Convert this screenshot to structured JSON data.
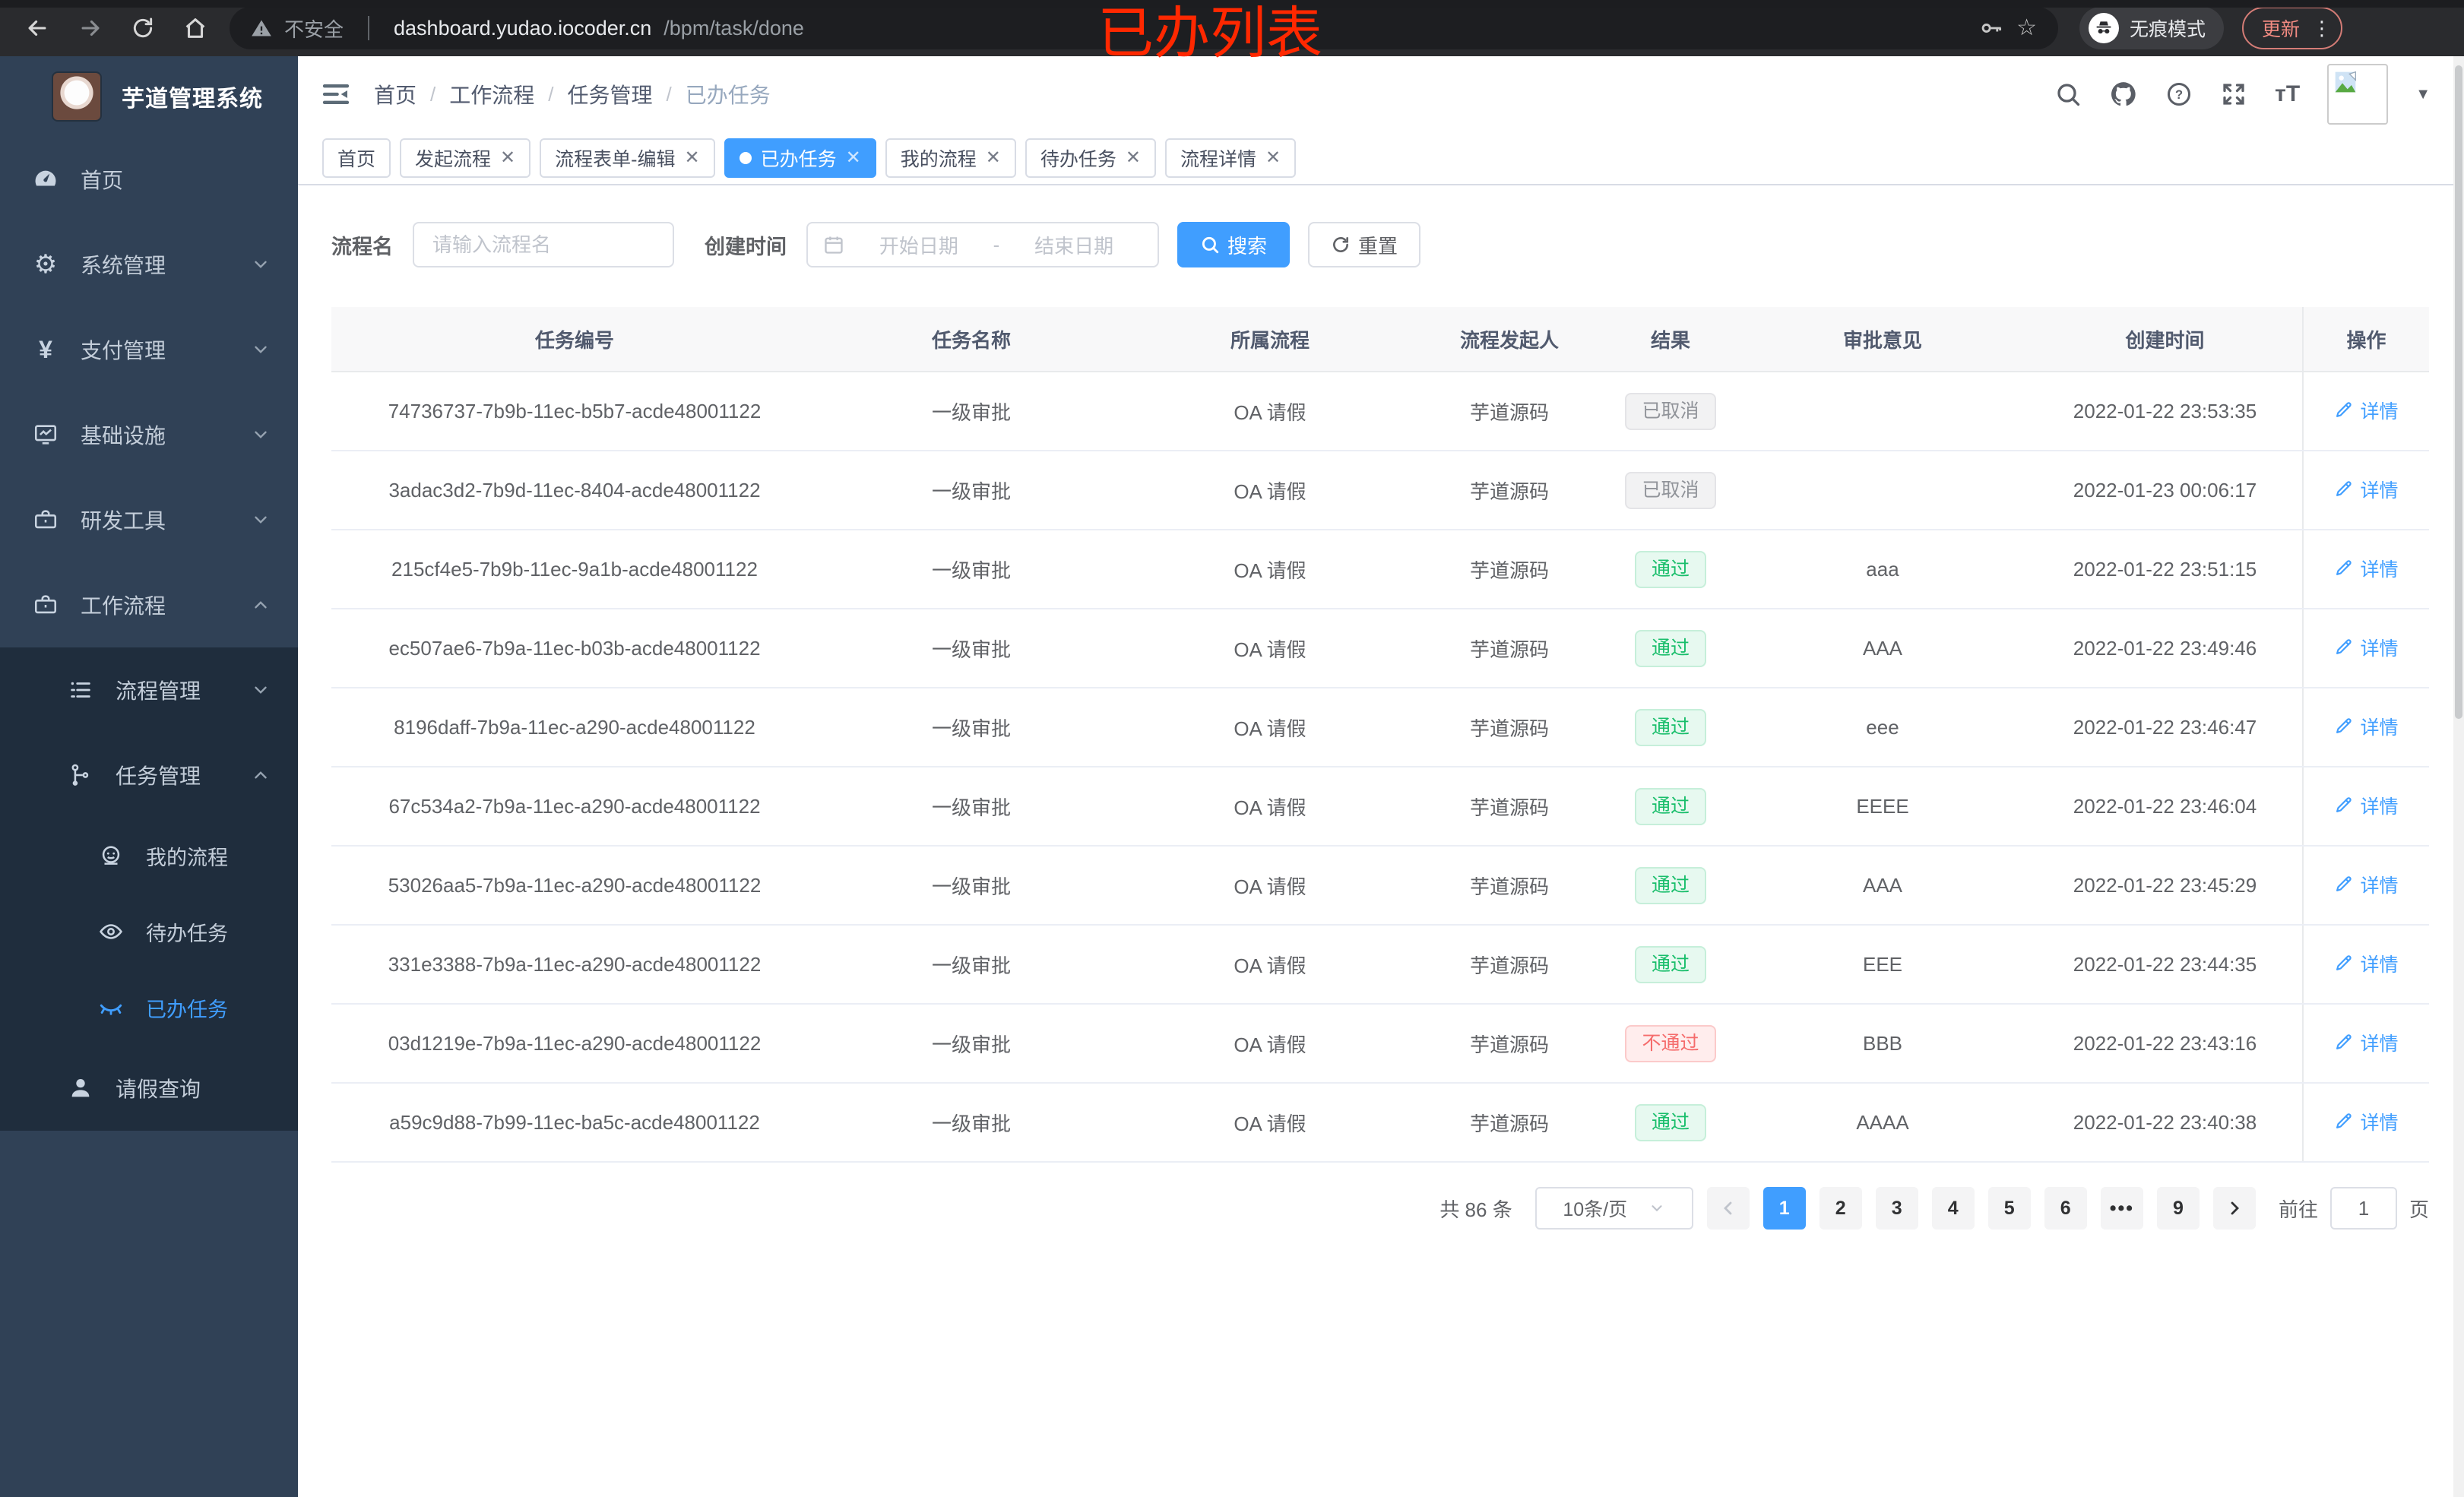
{
  "browser": {
    "security_label": "不安全",
    "url_host": "dashboard.yudao.iocoder.cn",
    "url_path": "/bpm/task/done",
    "incognito_label": "无痕模式",
    "update_label": "更新"
  },
  "annotation": {
    "text": "已办列表",
    "color": "#ff2800"
  },
  "sidebar": {
    "title": "芋道管理系统",
    "items": [
      {
        "label": "首页",
        "icon": "dashboard-icon",
        "depth": 1
      },
      {
        "label": "系统管理",
        "icon": "gear-icon",
        "depth": 1,
        "chevron": "down"
      },
      {
        "label": "支付管理",
        "icon": "yen-icon",
        "depth": 1,
        "chevron": "down"
      },
      {
        "label": "基础设施",
        "icon": "monitor-icon",
        "depth": 1,
        "chevron": "down"
      },
      {
        "label": "研发工具",
        "icon": "toolbox-icon",
        "depth": 1,
        "chevron": "down"
      },
      {
        "label": "工作流程",
        "icon": "toolbox-icon",
        "depth": 1,
        "chevron": "up"
      },
      {
        "label": "流程管理",
        "icon": "list-icon",
        "depth": 2,
        "chevron": "down",
        "dark": true
      },
      {
        "label": "任务管理",
        "icon": "tree-icon",
        "depth": 2,
        "chevron": "up",
        "dark": true
      },
      {
        "label": "我的流程",
        "icon": "robot-icon",
        "depth": 3,
        "dark": true
      },
      {
        "label": "待办任务",
        "icon": "eye-open-icon",
        "depth": 3,
        "dark": true
      },
      {
        "label": "已办任务",
        "icon": "eye-closed-icon",
        "depth": 3,
        "dark": true,
        "active": true
      },
      {
        "label": "请假查询",
        "icon": "user-icon",
        "depth": 2,
        "dark": true
      }
    ]
  },
  "header": {
    "breadcrumb": [
      "首页",
      "工作流程",
      "任务管理",
      "已办任务"
    ]
  },
  "tabs": [
    {
      "label": "首页",
      "closable": false
    },
    {
      "label": "发起流程",
      "closable": true
    },
    {
      "label": "流程表单-编辑",
      "closable": true
    },
    {
      "label": "已办任务",
      "closable": true,
      "active": true
    },
    {
      "label": "我的流程",
      "closable": true
    },
    {
      "label": "待办任务",
      "closable": true
    },
    {
      "label": "流程详情",
      "closable": true
    }
  ],
  "filters": {
    "name_label": "流程名",
    "name_placeholder": "请输入流程名",
    "time_label": "创建时间",
    "start_placeholder": "开始日期",
    "range_separator": "-",
    "end_placeholder": "结束日期",
    "search_label": "搜索",
    "reset_label": "重置"
  },
  "table": {
    "columns": [
      "任务编号",
      "任务名称",
      "所属流程",
      "流程发起人",
      "结果",
      "审批意见",
      "创建时间",
      "操作"
    ],
    "action_label": "详情",
    "rows": [
      {
        "id": "74736737-7b9b-11ec-b5b7-acde48001122",
        "name": "一级审批",
        "process": "OA 请假",
        "starter": "芋道源码",
        "result": "已取消",
        "comment": "",
        "time": "2022-01-22 23:53:35"
      },
      {
        "id": "3adac3d2-7b9d-11ec-8404-acde48001122",
        "name": "一级审批",
        "process": "OA 请假",
        "starter": "芋道源码",
        "result": "已取消",
        "comment": "",
        "time": "2022-01-23 00:06:17"
      },
      {
        "id": "215cf4e5-7b9b-11ec-9a1b-acde48001122",
        "name": "一级审批",
        "process": "OA 请假",
        "starter": "芋道源码",
        "result": "通过",
        "comment": "aaa",
        "time": "2022-01-22 23:51:15"
      },
      {
        "id": "ec507ae6-7b9a-11ec-b03b-acde48001122",
        "name": "一级审批",
        "process": "OA 请假",
        "starter": "芋道源码",
        "result": "通过",
        "comment": "AAA",
        "time": "2022-01-22 23:49:46"
      },
      {
        "id": "8196daff-7b9a-11ec-a290-acde48001122",
        "name": "一级审批",
        "process": "OA 请假",
        "starter": "芋道源码",
        "result": "通过",
        "comment": "eee",
        "time": "2022-01-22 23:46:47"
      },
      {
        "id": "67c534a2-7b9a-11ec-a290-acde48001122",
        "name": "一级审批",
        "process": "OA 请假",
        "starter": "芋道源码",
        "result": "通过",
        "comment": "EEEE",
        "time": "2022-01-22 23:46:04"
      },
      {
        "id": "53026aa5-7b9a-11ec-a290-acde48001122",
        "name": "一级审批",
        "process": "OA 请假",
        "starter": "芋道源码",
        "result": "通过",
        "comment": "AAA",
        "time": "2022-01-22 23:45:29"
      },
      {
        "id": "331e3388-7b9a-11ec-a290-acde48001122",
        "name": "一级审批",
        "process": "OA 请假",
        "starter": "芋道源码",
        "result": "通过",
        "comment": "EEE",
        "time": "2022-01-22 23:44:35"
      },
      {
        "id": "03d1219e-7b9a-11ec-a290-acde48001122",
        "name": "一级审批",
        "process": "OA 请假",
        "starter": "芋道源码",
        "result": "不通过",
        "comment": "BBB",
        "time": "2022-01-22 23:43:16"
      },
      {
        "id": "a59c9d88-7b99-11ec-ba5c-acde48001122",
        "name": "一级审批",
        "process": "OA 请假",
        "starter": "芋道源码",
        "result": "通过",
        "comment": "AAAA",
        "time": "2022-01-22 23:40:38"
      }
    ]
  },
  "pagination": {
    "total_label": "共 86 条",
    "page_size_label": "10条/页",
    "pages": [
      "1",
      "2",
      "3",
      "4",
      "5",
      "6",
      "•••",
      "9"
    ],
    "active_page": "1",
    "goto_label": "前往",
    "goto_value": "1",
    "goto_suffix": "页"
  },
  "colors": {
    "accent": "#409eff",
    "success": "#19be6b",
    "danger": "#f56c6c",
    "info": "#909399",
    "sidebar_bg": "#304156",
    "submenu_bg": "#1f2d3d",
    "annotation_red": "#ff2800"
  }
}
